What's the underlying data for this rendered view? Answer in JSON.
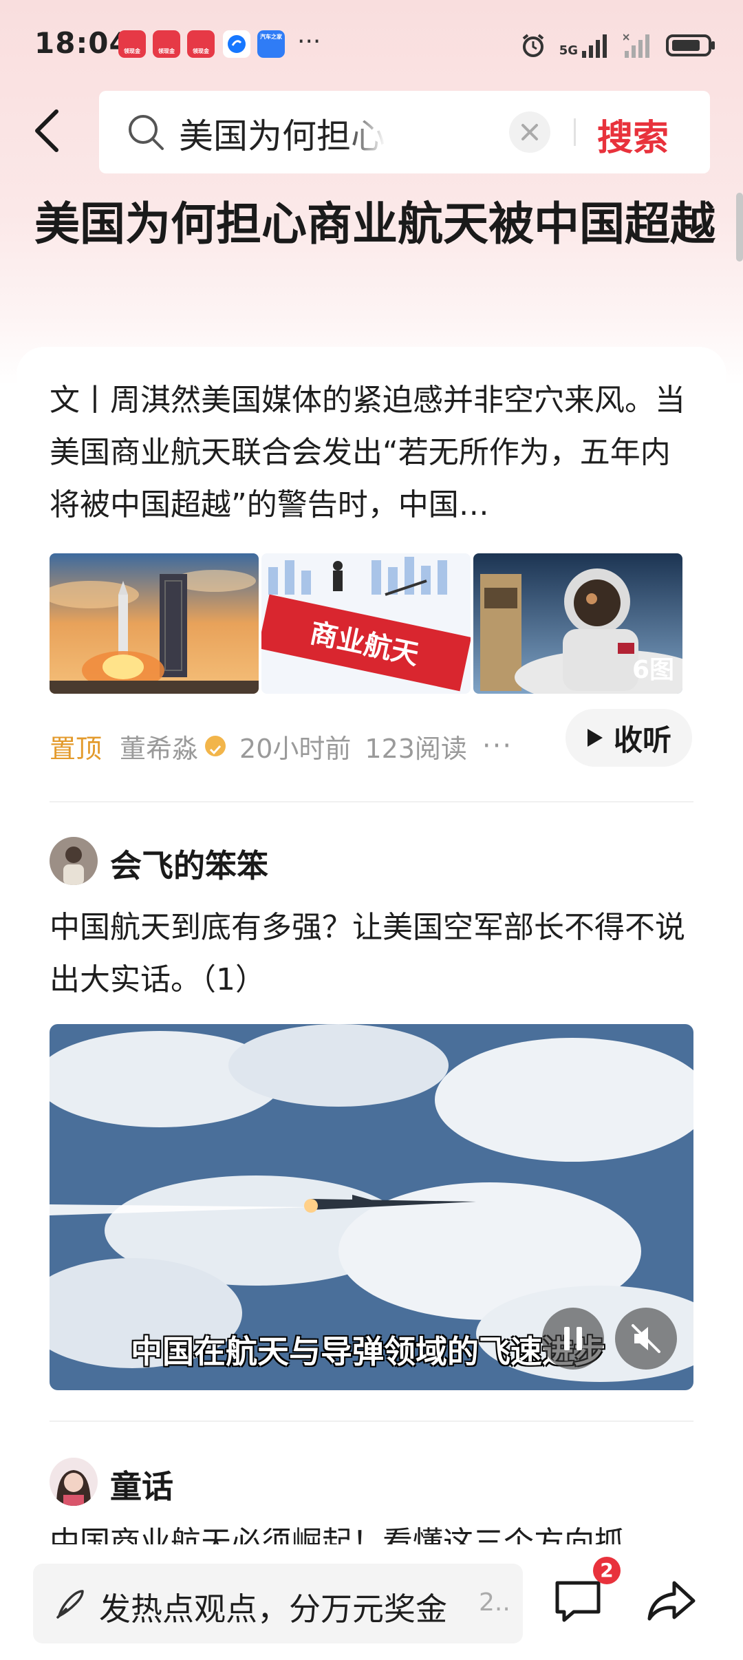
{
  "status_bar": {
    "time": "18:04",
    "app_icons": [
      {
        "label": "领现金",
        "color": "#e63946",
        "icon": "shop-icon"
      },
      {
        "label": "领现金",
        "color": "#e63946",
        "icon": "shop-icon"
      },
      {
        "label": "领现金",
        "color": "#e63946",
        "icon": "shop-icon"
      },
      {
        "label": "",
        "color": "#1677ff",
        "icon": "alipay-icon"
      },
      {
        "label": "汽车之家",
        "color": "#2f7cf6",
        "icon": "autohome-icon"
      }
    ],
    "more": "···",
    "network": "5G",
    "icons": [
      "alarm-icon",
      "signal-icon",
      "signal-2-icon",
      "battery-icon"
    ]
  },
  "search": {
    "query": "美国为何担心商业航天被中国超越",
    "button_label": "搜索"
  },
  "page_title": "美国为何担心商业航天被中国超越",
  "article": {
    "summary": "文丨周淇然美国媒体的紧迫感并非空穴来风。当美国商业航天联合会发出“若无所作为，五年内将被中国超越”的警告时，中国…",
    "images": [
      {
        "icon": "rocket-launch-image"
      },
      {
        "icon": "commercial-space-image",
        "text": "商业航天"
      },
      {
        "icon": "astronaut-image"
      }
    ],
    "image_count": "6图",
    "pinned_label": "置顶",
    "author": "董希淼",
    "time": "20小时前",
    "reads": "123阅读",
    "more": "···",
    "listen_label": "收听"
  },
  "post1": {
    "user": "会飞的笨笨",
    "text": "中国航天到底有多强？让美国空军部长不得不说出大实话。（1）",
    "video_subtitle": "中国在航天与导弹领域的飞速进步"
  },
  "post2": {
    "user": "童话",
    "text": "中国商业航天必须崛起！看懂这三个方向抓"
  },
  "bottom_bar": {
    "comment_placeholder": "发热点观点，分万元奖金",
    "comment_hint": "2..",
    "comment_badge": "2"
  },
  "colors": {
    "accent_red": "#e8323c",
    "pin_orange": "#e39a2b",
    "header_pink": "#f9dede"
  }
}
